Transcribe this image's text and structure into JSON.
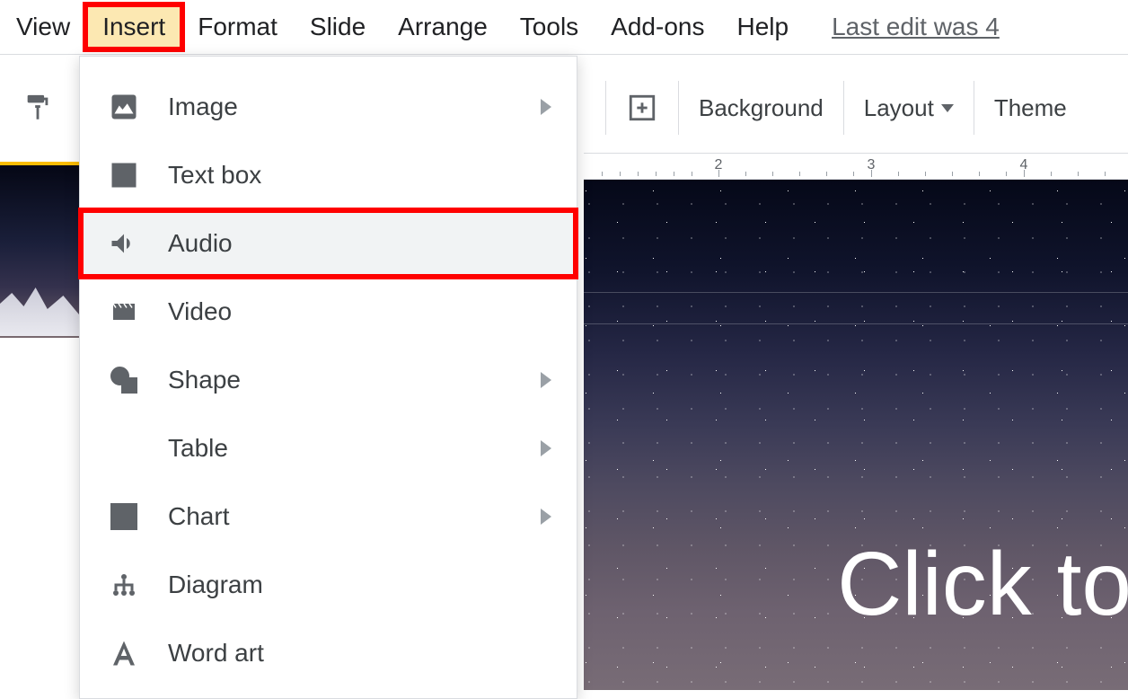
{
  "menubar": {
    "items": [
      {
        "label": "View"
      },
      {
        "label": "Insert",
        "highlighted": true
      },
      {
        "label": "Format"
      },
      {
        "label": "Slide"
      },
      {
        "label": "Arrange"
      },
      {
        "label": "Tools"
      },
      {
        "label": "Add-ons"
      },
      {
        "label": "Help"
      }
    ],
    "last_edit": "Last edit was 4"
  },
  "toolbar": {
    "background_label": "Background",
    "layout_label": "Layout",
    "theme_label": "Theme"
  },
  "insert_menu": {
    "items": [
      {
        "label": "Image",
        "has_sub": true,
        "icon": "image-icon"
      },
      {
        "label": "Text box",
        "has_sub": false,
        "icon": "textbox-icon"
      },
      {
        "label": "Audio",
        "has_sub": false,
        "icon": "audio-icon",
        "hover": true,
        "red_box": true
      },
      {
        "label": "Video",
        "has_sub": false,
        "icon": "video-icon"
      },
      {
        "label": "Shape",
        "has_sub": true,
        "icon": "shape-icon"
      },
      {
        "label": "Table",
        "has_sub": true,
        "icon": "table-icon"
      },
      {
        "label": "Chart",
        "has_sub": true,
        "icon": "chart-icon"
      },
      {
        "label": "Diagram",
        "has_sub": false,
        "icon": "diagram-icon"
      },
      {
        "label": "Word art",
        "has_sub": false,
        "icon": "wordart-icon"
      }
    ]
  },
  "ruler": {
    "labels": [
      "2",
      "3",
      "4"
    ]
  },
  "canvas": {
    "placeholder_text": "Click to"
  }
}
